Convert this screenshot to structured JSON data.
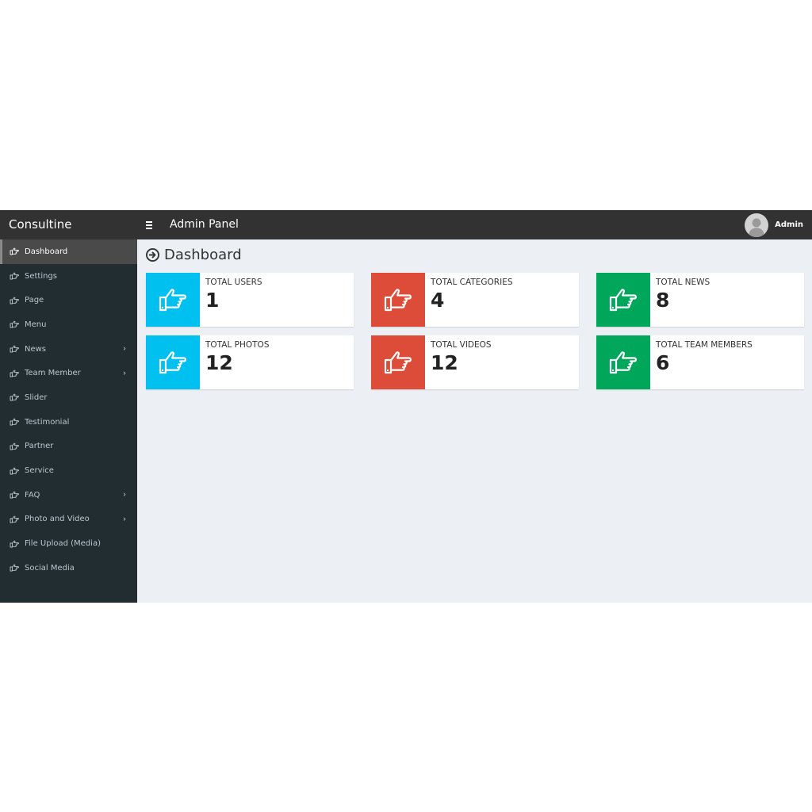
{
  "header": {
    "brand": "Consultine",
    "title": "Admin Panel",
    "user_name": "Admin"
  },
  "sidebar": {
    "items": [
      {
        "label": "Dashboard",
        "active": true,
        "has_children": false
      },
      {
        "label": "Settings",
        "active": false,
        "has_children": false
      },
      {
        "label": "Page",
        "active": false,
        "has_children": false
      },
      {
        "label": "Menu",
        "active": false,
        "has_children": false
      },
      {
        "label": "News",
        "active": false,
        "has_children": true
      },
      {
        "label": "Team Member",
        "active": false,
        "has_children": true
      },
      {
        "label": "Slider",
        "active": false,
        "has_children": false
      },
      {
        "label": "Testimonial",
        "active": false,
        "has_children": false
      },
      {
        "label": "Partner",
        "active": false,
        "has_children": false
      },
      {
        "label": "Service",
        "active": false,
        "has_children": false
      },
      {
        "label": "FAQ",
        "active": false,
        "has_children": true
      },
      {
        "label": "Photo and Video",
        "active": false,
        "has_children": true
      },
      {
        "label": "File Upload (Media)",
        "active": false,
        "has_children": false
      },
      {
        "label": "Social Media",
        "active": false,
        "has_children": false
      }
    ],
    "item_icon": "hand-point-right-icon",
    "chevron_icon": "chevron-right-icon"
  },
  "main": {
    "page_title": "Dashboard",
    "page_icon": "arrow-circle-right-icon",
    "stats": [
      {
        "label": "TOTAL USERS",
        "value": "1",
        "color": "#00c0ef"
      },
      {
        "label": "TOTAL CATEGORIES",
        "value": "4",
        "color": "#dd4b39"
      },
      {
        "label": "TOTAL NEWS",
        "value": "8",
        "color": "#00a65a"
      },
      {
        "label": "TOTAL PHOTOS",
        "value": "12",
        "color": "#00c0ef"
      },
      {
        "label": "TOTAL VIDEOS",
        "value": "12",
        "color": "#dd4b39"
      },
      {
        "label": "TOTAL TEAM MEMBERS",
        "value": "6",
        "color": "#00a65a"
      }
    ],
    "stat_icon": "thumbs-up-icon"
  },
  "colors": {
    "header_bg": "#323232",
    "sidebar_bg": "#222d32",
    "content_bg": "#ecf0f5"
  }
}
